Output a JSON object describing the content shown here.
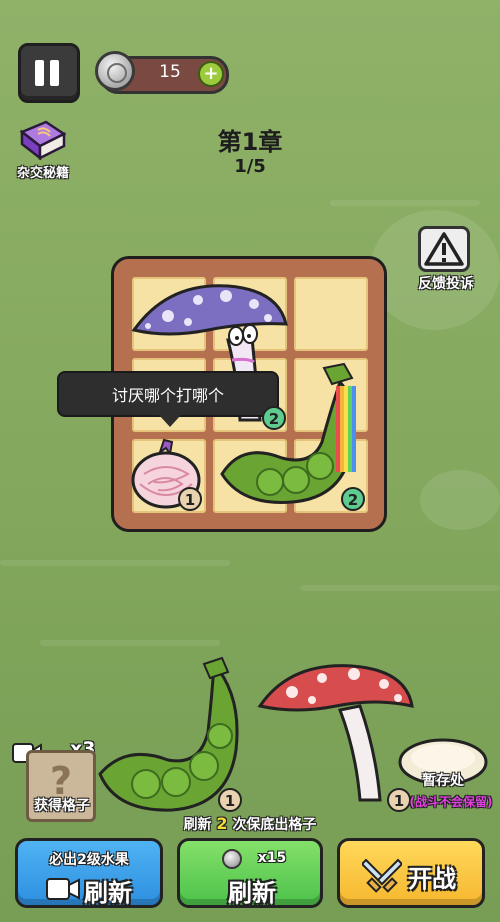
{
  "top_bar": {
    "coins": "15"
  },
  "recipe_book": {
    "label": "杂交秘籍"
  },
  "chapter": {
    "title": "第1章",
    "progress": "1/5"
  },
  "feedback": {
    "label": "反馈投诉"
  },
  "board": {
    "tooltip": "讨厌哪个打哪个",
    "units": [
      {
        "name": "purple-mushroom",
        "level": "2"
      },
      {
        "name": "onion",
        "level": "1"
      },
      {
        "name": "rainbow-pea-pod",
        "level": "2"
      }
    ]
  },
  "bench": {
    "pea_pod_level": "1",
    "red_mushroom_level": "1"
  },
  "get_slot": {
    "multiplier": "x3",
    "label": "获得格子"
  },
  "storage": {
    "label": "暂存处",
    "note": "(战斗不会保留)"
  },
  "hint": {
    "prefix": "刷新",
    "count": "2",
    "suffix": "次保底出格子"
  },
  "buttons": {
    "ad_refresh": {
      "subtitle": "必出2级水果",
      "label": "刷新"
    },
    "coin_refresh": {
      "cost": "x15",
      "label": "刷新"
    },
    "start_battle": {
      "label": "开战"
    }
  },
  "colors": {
    "background": "#86aa60",
    "board": "#b5714f",
    "cell": "#f6e2a4",
    "blue_button": "#2d8fe0",
    "green_button": "#4cc24a",
    "yellow_button": "#f6b72f"
  }
}
